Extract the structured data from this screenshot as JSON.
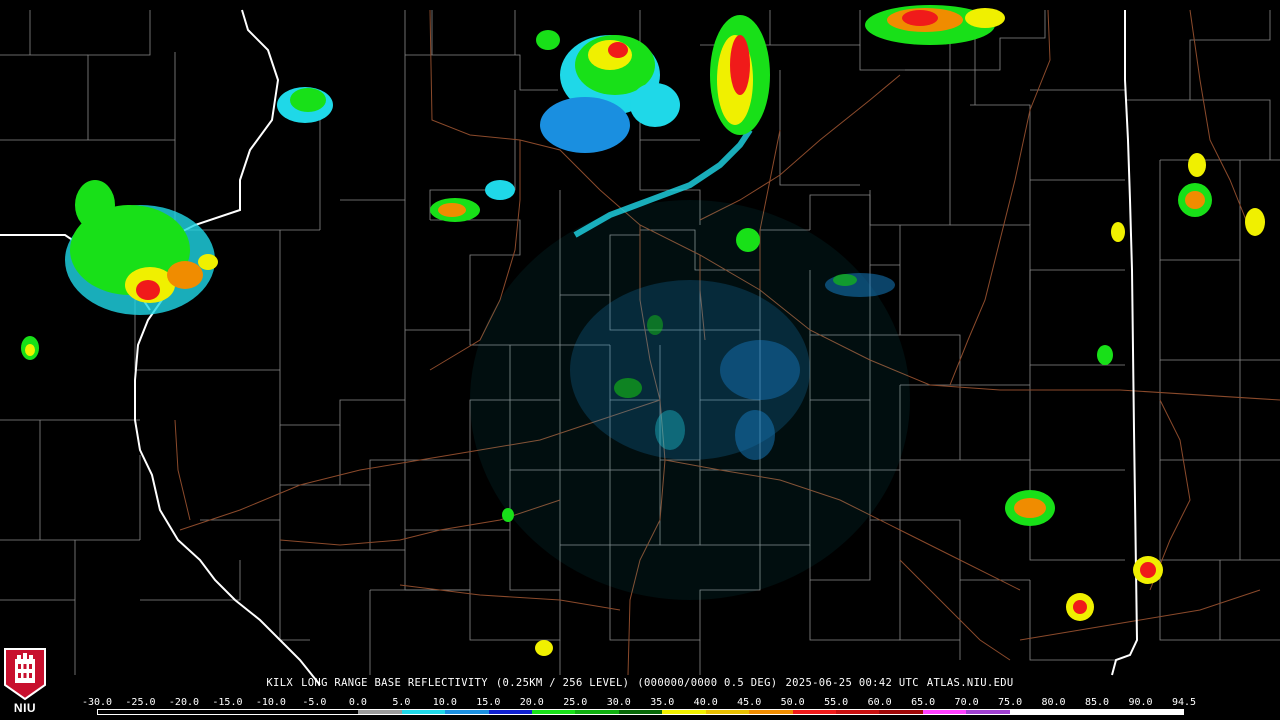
{
  "product_caption": {
    "station": "KILX",
    "product": "LONG RANGE BASE REFLECTIVITY",
    "resolution": "(0.25KM / 256 LEVEL)",
    "scan": "(000000/0000 0.5 DEG)",
    "timestamp": "2025-06-25 00:42 UTC",
    "source": "ATLAS.NIU.EDU"
  },
  "logo": {
    "text": "NIU",
    "color": "#c8102e"
  },
  "legend": {
    "labels": [
      "-30.0",
      "-25.0",
      "-20.0",
      "-15.0",
      "-10.0",
      "-5.0",
      "0.0",
      "5.0",
      "10.0",
      "15.0",
      "20.0",
      "25.0",
      "30.0",
      "35.0",
      "40.0",
      "45.0",
      "50.0",
      "55.0",
      "60.0",
      "65.0",
      "70.0",
      "75.0",
      "80.0",
      "85.0",
      "90.0",
      "94.5"
    ],
    "colors": [
      "#000000",
      "#000000",
      "#000000",
      "#000000",
      "#000000",
      "#000000",
      "#9a9a9a",
      "#1fd8e8",
      "#1a8fe0",
      "#1020d0",
      "#18e018",
      "#10b010",
      "#086808",
      "#f0f000",
      "#e8c000",
      "#f08c00",
      "#f01a1a",
      "#c81010",
      "#a00808",
      "#ff40ff",
      "#a040d0",
      "#ffffff",
      "#ffffff",
      "#ffffff",
      "#ffffff"
    ]
  },
  "map_colors": {
    "county_lines": "#8a8a8a",
    "state_lines": "#ffffff",
    "roads": "#8b4a2b",
    "background": "#000000"
  }
}
